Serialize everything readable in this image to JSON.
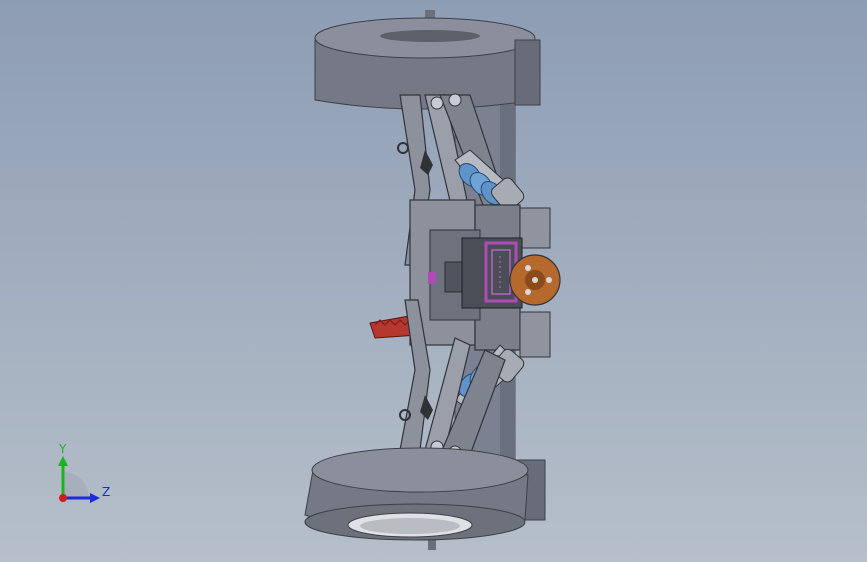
{
  "viewport": {
    "background_top": "#8d9db3",
    "background_bottom": "#b6bfca"
  },
  "model": {
    "body_color": "#6f7582",
    "housing_color": "#8a8f9b",
    "spring_color": "#5f93c9",
    "connector_color": "#b04ab5",
    "gear_color": "#b5372f",
    "motor_color": "#b5692d"
  },
  "triad": {
    "y_label": "Y",
    "z_label": "Z",
    "y_color": "#1db320",
    "z_color": "#1b2bd6",
    "x_color": "#d21b1b"
  }
}
